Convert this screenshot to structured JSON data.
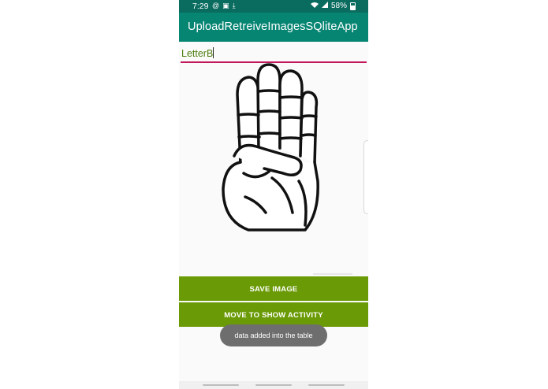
{
  "status_bar": {
    "time": "7:29",
    "battery": "58%",
    "icons": [
      "alarm-icon",
      "image-icon",
      "download-icon",
      "wifi-icon",
      "signal-icon",
      "battery-icon"
    ]
  },
  "app_bar": {
    "title": "UploadRetreiveImagesSQliteApp"
  },
  "name_input": {
    "value": "LetterB"
  },
  "buttons": {
    "save": "SAVE IMAGE",
    "move": "MOVE TO SHOW ACTIVITY"
  },
  "toast": {
    "message": "data added into the table"
  },
  "colors": {
    "status_bar": "#0a6b5f",
    "app_bar": "#078573",
    "button": "#6a9a06",
    "input_underline": "#c2185b",
    "input_text": "#4e7d10",
    "toast": "#6e6e6e"
  }
}
